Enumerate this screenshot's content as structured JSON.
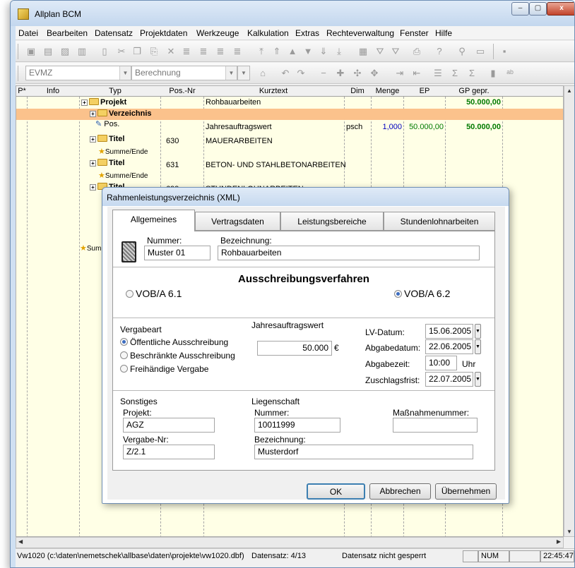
{
  "window": {
    "title": "Allplan BCM",
    "min": "–",
    "max": "▢",
    "close": "x"
  },
  "menu": [
    "Datei",
    "Bearbeiten",
    "Datensatz",
    "Projektdaten",
    "Werkzeuge",
    "Kalkulation",
    "Extras",
    "Rechteverwaltung",
    "Fenster",
    "Hilfe"
  ],
  "toolbar2": {
    "combo1": "EVMZ",
    "combo2": "Berechnung",
    "combo3": ""
  },
  "grid": {
    "headers": [
      "P*",
      "Info",
      "Typ",
      "Pos.-Nr",
      "Kurztext",
      "Dim",
      "Menge",
      "EP",
      "GP gepr."
    ],
    "rows": [
      {
        "typ": "Projekt",
        "pos": "",
        "kurztext": "Rohbauarbeiten",
        "dim": "",
        "menge": "",
        "ep": "",
        "gp": "50.000,00"
      },
      {
        "typ": "Verzeichnis",
        "pos": "",
        "kurztext": "",
        "dim": "",
        "menge": "",
        "ep": "",
        "gp": ""
      },
      {
        "typ": "Pos.",
        "pos": "",
        "kurztext": "Jahresauftragswert",
        "dim": "psch",
        "menge": "1,000",
        "ep": "50.000,00",
        "gp": "50.000,00"
      },
      {
        "typ": "Titel",
        "pos": "630",
        "kurztext": "MAUERARBEITEN",
        "dim": "",
        "menge": "",
        "ep": "",
        "gp": ""
      },
      {
        "typ": "Summe/Ende",
        "pos": "",
        "kurztext": "",
        "dim": "",
        "menge": "",
        "ep": "",
        "gp": ""
      },
      {
        "typ": "Titel",
        "pos": "631",
        "kurztext": "BETON- UND STAHLBETONARBEITEN",
        "dim": "",
        "menge": "",
        "ep": "",
        "gp": ""
      },
      {
        "typ": "Summe/Ende",
        "pos": "",
        "kurztext": "",
        "dim": "",
        "menge": "",
        "ep": "",
        "gp": ""
      },
      {
        "typ": "Titel",
        "pos": "699",
        "kurztext": "STUNDENLOHNARBEITEN",
        "dim": "",
        "menge": "",
        "ep": "",
        "gp": ""
      }
    ],
    "partial_row": "Summe/Ende"
  },
  "statusbar": {
    "path": "Vw1020 (c:\\daten\\nemetschek\\allbase\\daten\\projekte\\vw1020.dbf)",
    "record": "Datensatz: 4/13",
    "lock": "Datensatz nicht gesperrt",
    "num": "NUM",
    "time": "22:45:47"
  },
  "dialog": {
    "title": "Rahmenleistungsverzeichnis (XML)",
    "tabs": [
      "Allgemeines",
      "Vertragsdaten",
      "Leistungsbereiche",
      "Stundenlohnarbeiten"
    ],
    "nummer_label": "Nummer:",
    "nummer": "Muster 01",
    "bezeichnung_label": "Bezeichnung:",
    "bezeichnung": "Rohbauarbeiten",
    "verfahren_title": "Ausschreibungsverfahren",
    "vob61": "VOB/A 6.1",
    "vob62": "VOB/A 6.2",
    "vergabeart_label": "Vergabeart",
    "vergabe_options": [
      "Öffentliche Ausschreibung",
      "Beschränkte Ausschreibung",
      "Freihändige Vergabe"
    ],
    "jahres_label": "Jahresauftragswert",
    "jahres_value": "50.000",
    "currency": "€",
    "lv_datum_label": "LV-Datum:",
    "lv_datum": "15.06.2005",
    "abgabedatum_label": "Abgabedatum:",
    "abgabedatum": "22.06.2005",
    "abgabezeit_label": "Abgabezeit:",
    "abgabezeit": "10:00",
    "uhr": "Uhr",
    "zuschlag_label": "Zuschlagsfrist:",
    "zuschlag": "22.07.2005",
    "sonstiges_label": "Sonstiges",
    "projekt_label": "Projekt:",
    "projekt": "AGZ",
    "vergabenr_label": "Vergabe-Nr:",
    "vergabenr": "Z/2.1",
    "liegenschaft_label": "Liegenschaft",
    "lg_nummer_label": "Nummer:",
    "lg_nummer": "10011999",
    "massnahme_label": "Maßnahmenummer:",
    "massnahme": "",
    "lg_bez_label": "Bezeichnung:",
    "lg_bez": "Musterdorf",
    "ok": "OK",
    "cancel": "Abbrechen",
    "apply": "Übernehmen"
  },
  "colors": {
    "gp_green": "#007a00",
    "menge_blue": "#0000c0",
    "highlight": "#fbc28c",
    "grid_bg": "#ffffe6"
  }
}
